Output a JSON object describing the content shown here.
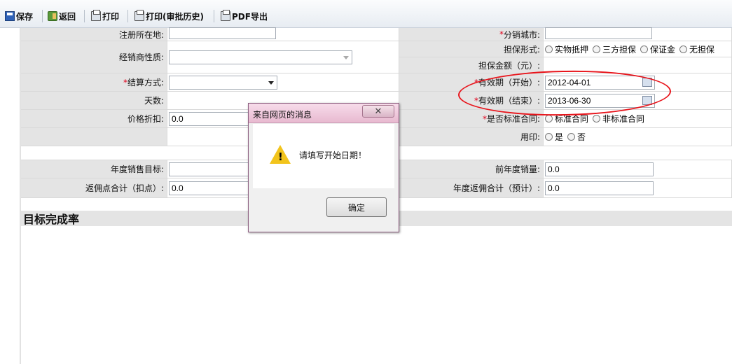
{
  "toolbar": {
    "save": "保存",
    "back": "返回",
    "print": "打印",
    "print_history": "打印(审批历史)",
    "pdf_export": "PDF导出"
  },
  "form": {
    "register_location_label": "注册所在地:",
    "dist_city_label": "分销城市:",
    "dealer_nature_label": "经销商性质:",
    "guarantee_form_label": "担保形式:",
    "guarantee_options": [
      "实物抵押",
      "三方担保",
      "保证金",
      "无担保"
    ],
    "guarantee_amount_label": "担保金额（元）:",
    "settle_method_label": "结算方式:",
    "valid_start_label": "有效期（开始）:",
    "valid_start_value": "2012-04-01",
    "days_label": "天数:",
    "valid_end_label": "有效期（结束）:",
    "valid_end_value": "2013-06-30",
    "price_discount_label": "价格折扣:",
    "price_discount_value": "0.0",
    "standard_contract_label": "是否标准合同:",
    "contract_options": [
      "标准合同",
      "非标准合同"
    ],
    "seal_label": "用印:",
    "seal_options": [
      "是",
      "否"
    ],
    "annual_target_label": "年度销售目标:",
    "prev_year_sales_label": "前年度销量:",
    "prev_year_sales_value": "0.0",
    "rebate_total_label": "返佣点合计（扣点）:",
    "rebate_total_value": "0.0",
    "annual_rebate_label": "年度返佣合计（预计）:",
    "annual_rebate_value": "0.0",
    "required_mark": "*"
  },
  "section": {
    "title": "目标完成率"
  },
  "dialog": {
    "title": "来自网页的消息",
    "message": "请填写开始日期！",
    "ok": "确定",
    "close": "✕"
  },
  "colors": {
    "annotation": "#e8141b",
    "label_bg": "#e4e4e4",
    "dialog_title": "#e8b9d0"
  }
}
